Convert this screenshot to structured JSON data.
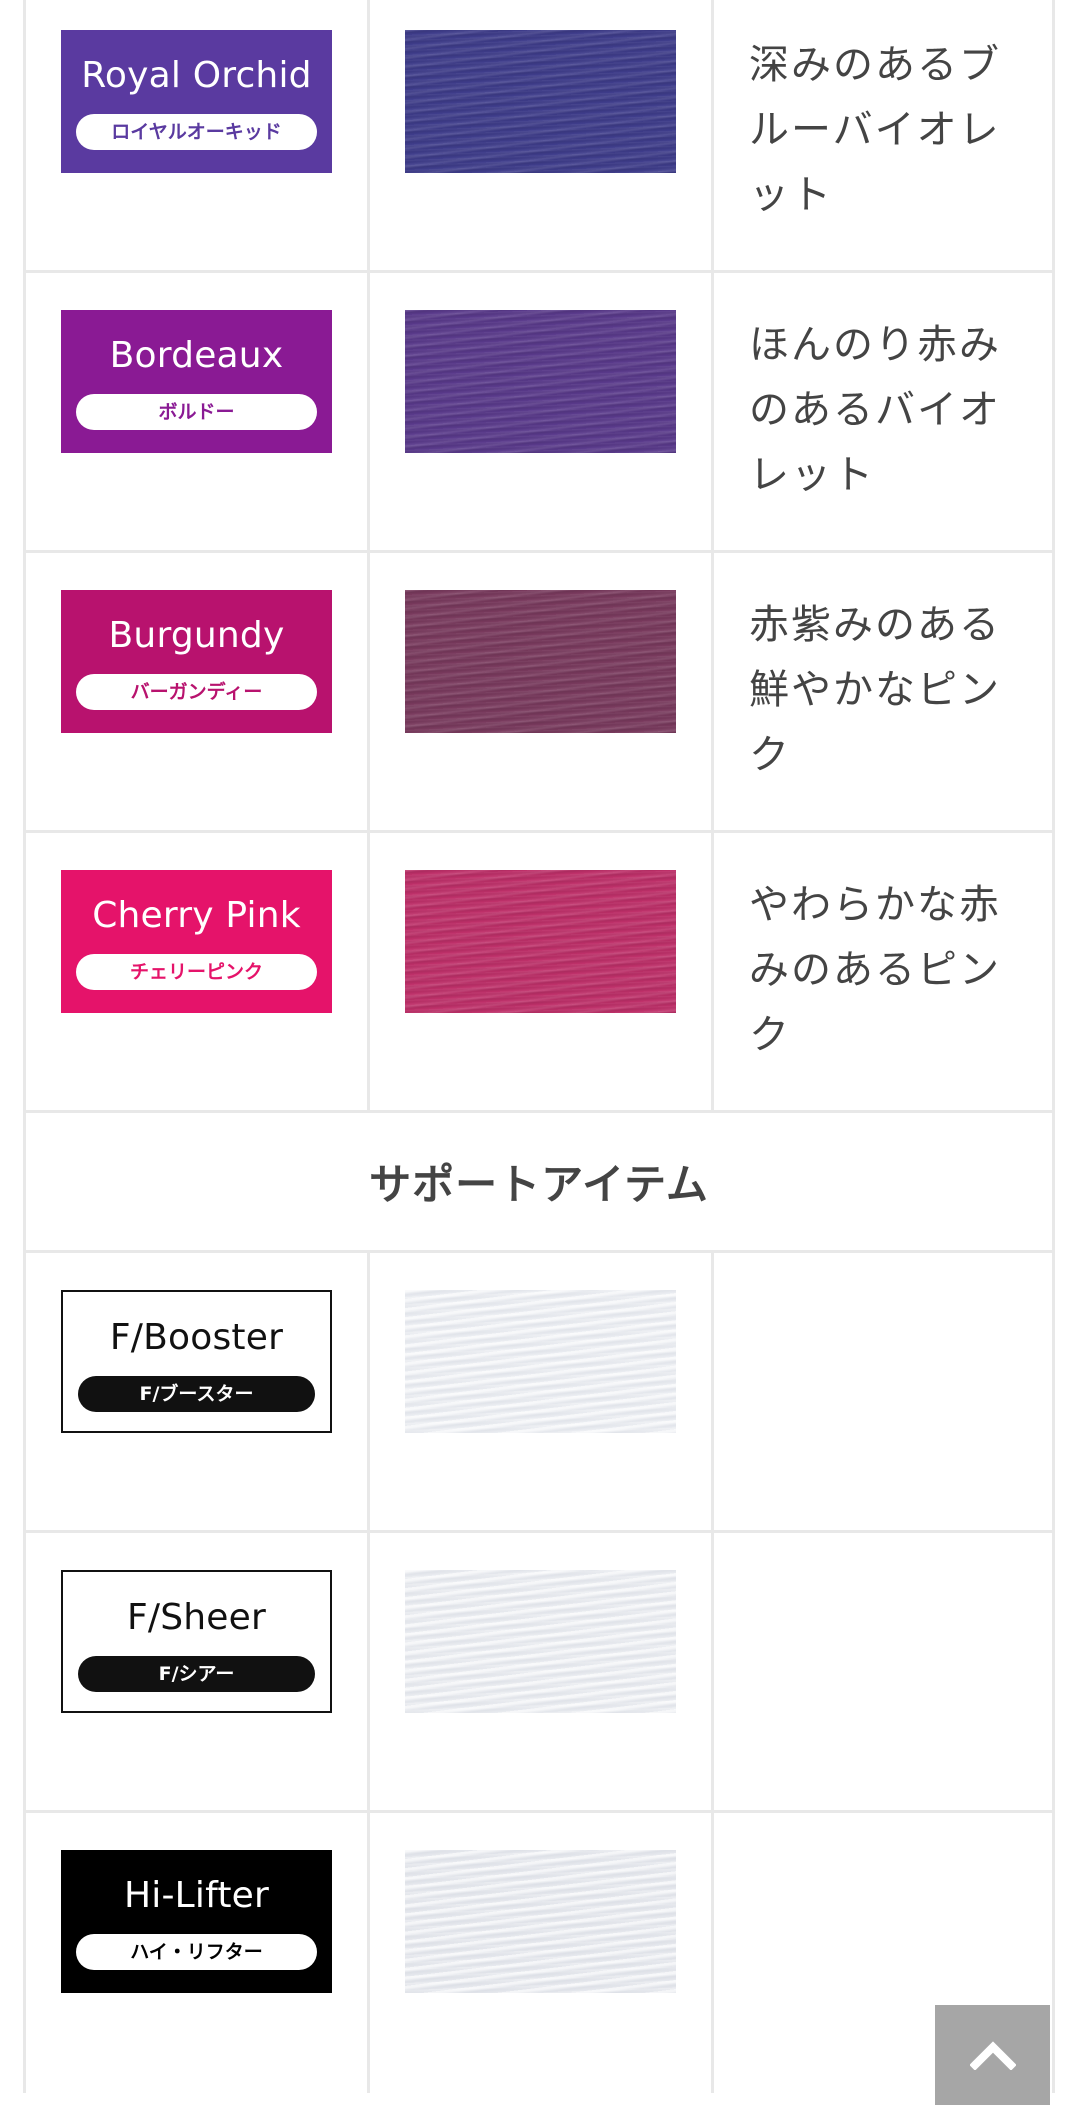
{
  "colors": {
    "border": "#e8e8e8",
    "text": "#444444",
    "back_to_top_bg": "#a6a6a6"
  },
  "color_rows": [
    {
      "name": "Royal Orchid",
      "kana": "ロイヤルオーキッド",
      "label_bg": "#5a3aa0",
      "pill_text_color": "#5a3aa0",
      "swatch_color": "#3f3d8c",
      "description": "深みのあるブルーバイオレット"
    },
    {
      "name": "Bordeaux",
      "kana": "ボルドー",
      "label_bg": "#8a1a94",
      "pill_text_color": "#8a1a94",
      "swatch_color": "#5a3a8c",
      "description": "ほんのり赤みのあるバイオレット"
    },
    {
      "name": "Burgundy",
      "kana": "バーガンディー",
      "label_bg": "#b8126e",
      "pill_text_color": "#b8126e",
      "swatch_color": "#7a3a5e",
      "description": "赤紫みのある鮮やかなピンク"
    },
    {
      "name": "Cherry Pink",
      "kana": "チェリーピンク",
      "label_bg": "#e5136a",
      "pill_text_color": "#e5136a",
      "swatch_color": "#c0306a",
      "description": "やわらかな赤みのあるピンク"
    }
  ],
  "support_section": {
    "title": "サポートアイテム"
  },
  "support_rows": [
    {
      "name": "F/Booster",
      "kana": "F/ブースター",
      "style": "white",
      "swatch_color": "#eef0f4"
    },
    {
      "name": "F/Sheer",
      "kana": "F/シアー",
      "style": "white",
      "swatch_color": "#eceef2"
    },
    {
      "name": "Hi-Lifter",
      "kana": "ハイ・リフター",
      "style": "black",
      "swatch_color": "#e8eaef"
    }
  ],
  "back_to_top": {
    "icon": "chevron-up-icon"
  }
}
